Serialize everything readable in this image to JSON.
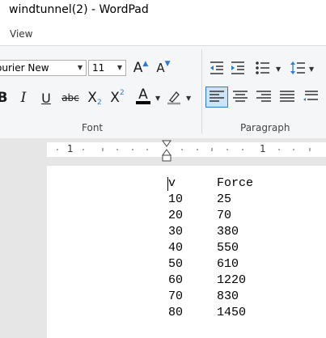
{
  "window": {
    "title": "windtunnel(2) - WordPad"
  },
  "menu": {
    "view_label": "View"
  },
  "font_group": {
    "label": "Font",
    "font_name": "ourier New",
    "font_size": "11",
    "bold": "B",
    "italic": "I",
    "underline": "U",
    "strikethrough": "abc",
    "subscript": "X",
    "subscript_mark": "2",
    "superscript": "X",
    "superscript_mark": "2",
    "font_color": "A",
    "grow": "A",
    "shrink": "A"
  },
  "paragraph_group": {
    "label": "Paragraph"
  },
  "ruler": {
    "left_number": "1",
    "right_number": "1"
  },
  "document": {
    "header": {
      "col1": "v",
      "col2": "Force"
    },
    "rows": [
      {
        "v": "10",
        "force": "25"
      },
      {
        "v": "20",
        "force": "70"
      },
      {
        "v": "30",
        "force": "380"
      },
      {
        "v": "40",
        "force": "550"
      },
      {
        "v": "50",
        "force": "610"
      },
      {
        "v": "60",
        "force": "1220"
      },
      {
        "v": "70",
        "force": "830"
      },
      {
        "v": "80",
        "force": "1450"
      }
    ]
  },
  "colors": {
    "accent": "#cce4f7",
    "accent_border": "#2b7bd3",
    "font_color_bar": "#000000"
  }
}
